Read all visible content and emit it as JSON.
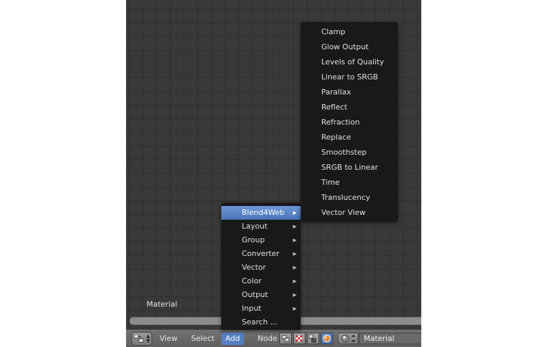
{
  "node_tree_label": "Material",
  "header": {
    "menus": [
      "View",
      "Select",
      "Add",
      "Node"
    ],
    "active_menu": "Add",
    "material_name": "Material"
  },
  "add_menu": {
    "items": [
      {
        "label": "Blend4Web",
        "submenu": true,
        "highlighted": true
      },
      {
        "label": "Layout",
        "submenu": true
      },
      {
        "label": "Group",
        "submenu": true
      },
      {
        "label": "Converter",
        "submenu": true
      },
      {
        "label": "Vector",
        "submenu": true
      },
      {
        "label": "Color",
        "submenu": true
      },
      {
        "label": "Output",
        "submenu": true
      },
      {
        "label": "Input",
        "submenu": true
      },
      {
        "label": "Search ...",
        "submenu": false
      }
    ]
  },
  "blend4web_submenu": {
    "items": [
      "Clamp",
      "Glow Output",
      "Levels of Quality",
      "Linear to SRGB",
      "Parallax",
      "Reflect",
      "Refraction",
      "Replace",
      "Smoothstep",
      "SRGB to Linear",
      "Time",
      "Translucency",
      "Vector View"
    ]
  },
  "icons": {
    "editor_type": "node-editor-icon",
    "tree_types": [
      "shader-nodes-icon",
      "texture-nodes-icon",
      "compositing-nodes-icon",
      "material-sphere-icon"
    ],
    "browse": "material-browse-icon"
  },
  "colors": {
    "highlight": "#5680c2",
    "menu_bg": "#191919",
    "grid_bg": "#393939"
  }
}
